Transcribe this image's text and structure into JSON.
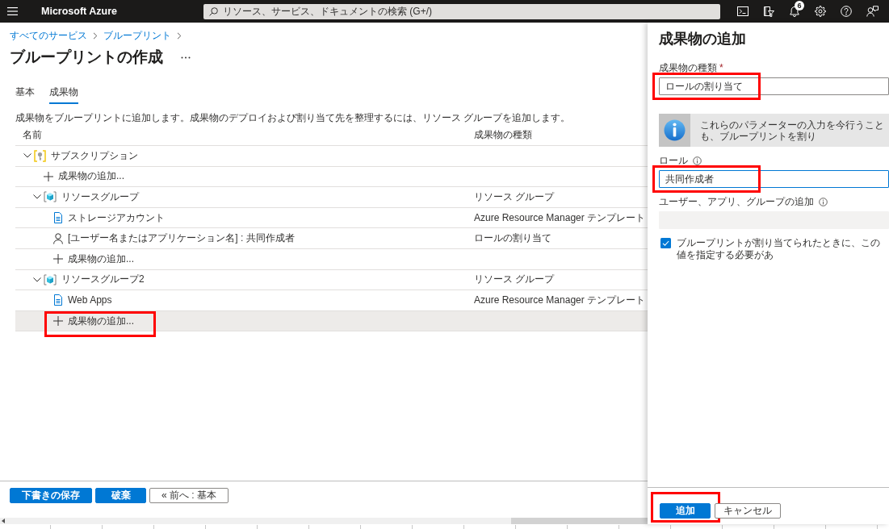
{
  "top_bar": {
    "brand": "Microsoft Azure",
    "search": {
      "placeholder": "リソース、サービス、ドキュメントの検索 (G+/)"
    },
    "tools": [
      {
        "kind": "terminal"
      },
      {
        "kind": "directory"
      },
      {
        "kind": "notifications",
        "badge": "6"
      },
      {
        "kind": "settings"
      },
      {
        "kind": "help"
      },
      {
        "kind": "feedback"
      }
    ]
  },
  "breadcrumb": [
    {
      "label": "すべてのサービス"
    },
    {
      "label": "ブループリント"
    }
  ],
  "page": {
    "title": "ブループリントの作成"
  },
  "tabs": [
    {
      "label": "基本",
      "selected": false
    },
    {
      "label": "成果物",
      "selected": true
    }
  ],
  "description": "成果物をブループリントに追加します。成果物のデプロイおよび割り当て先を整理するには、リソース グループを追加します。",
  "table": {
    "columns": [
      "名前",
      "成果物の種類"
    ],
    "rows": [
      {
        "kind": "subscription",
        "name": "サブスクリプション",
        "expanded": true,
        "selected": false,
        "highlighted": false,
        "children": [
          {
            "kind": "add",
            "name": "成果物の追加...",
            "selected": false,
            "highlighted": false
          },
          {
            "kind": "resource_group",
            "name": "リソースグループ",
            "type": "リソース グループ",
            "expanded": true,
            "selected": false,
            "highlighted": false,
            "children": [
              {
                "kind": "template",
                "name": "ストレージアカウント",
                "type": "Azure Resource Manager テンプレート",
                "selected": false,
                "highlighted": false
              },
              {
                "kind": "role",
                "name": "[ユーザー名またはアプリケーション名] : 共同作成者",
                "type": "ロールの割り当て",
                "selected": false,
                "highlighted": false
              },
              {
                "kind": "add",
                "name": "成果物の追加...",
                "selected": false,
                "highlighted": false
              }
            ]
          },
          {
            "kind": "resource_group",
            "name": "リソースグループ2",
            "type": "リソース グループ",
            "expanded": true,
            "selected": false,
            "highlighted": false,
            "children": [
              {
                "kind": "template",
                "name": "Web Apps",
                "type": "Azure Resource Manager テンプレート",
                "selected": false,
                "highlighted": false
              },
              {
                "kind": "add",
                "name": "成果物の追加...",
                "selected": true,
                "highlighted": true
              }
            ]
          }
        ]
      }
    ]
  },
  "footer_buttons": [
    {
      "label": "下書きの保存",
      "kind": "primary"
    },
    {
      "label": "破棄",
      "kind": "primary"
    },
    {
      "label": "« 前へ : 基本",
      "kind": "secondary"
    }
  ],
  "panel": {
    "title": "成果物の追加",
    "fields": [
      {
        "kind": "input",
        "label": "成果物の種類",
        "required_mark": "*",
        "tip": false,
        "value": "ロールの割り当て",
        "focused": false,
        "disabled": false,
        "highlighted": true
      },
      {
        "kind": "notice",
        "text": "これらのパラメーターの入力を今行うことも、ブループリントを割り"
      },
      {
        "kind": "input",
        "label": "ロール",
        "tip": true,
        "value": "共同作成者",
        "focused": true,
        "disabled": false,
        "highlighted": true
      },
      {
        "kind": "input",
        "label": "ユーザー、アプリ、グループの追加",
        "tip": true,
        "focused": false,
        "disabled": true,
        "highlighted": false
      },
      {
        "kind": "checkbox",
        "label": "ブループリントが割り当てられたときに、この値を指定する必要があ",
        "checked": true
      }
    ],
    "buttons": [
      {
        "label": "追加",
        "kind": "primary",
        "highlighted": true
      },
      {
        "label": "キャンセル",
        "kind": "secondary",
        "highlighted": false
      }
    ]
  }
}
